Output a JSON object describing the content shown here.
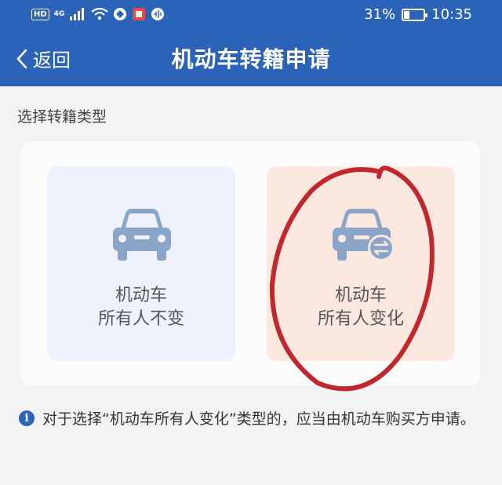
{
  "status_bar": {
    "hd_badge": "HD",
    "network": "4G",
    "battery_text": "31%",
    "battery_level": 0.31,
    "time": "10:35"
  },
  "nav": {
    "back_label": "返回",
    "title": "机动车转籍申请"
  },
  "section_label": "选择转籍类型",
  "options": [
    {
      "line1": "机动车",
      "line2": "所有人不变",
      "icon": "car-icon"
    },
    {
      "line1": "机动车",
      "line2": "所有人变化",
      "icon": "car-transfer-icon"
    }
  ],
  "notice": {
    "icon": "info-icon",
    "text": "对于选择“机动车所有人变化”类型的，应当由机动车购买方申请。"
  },
  "colors": {
    "header": "#2b63b8",
    "icon": "#8aa5c8",
    "annotation": "#c0282d"
  }
}
